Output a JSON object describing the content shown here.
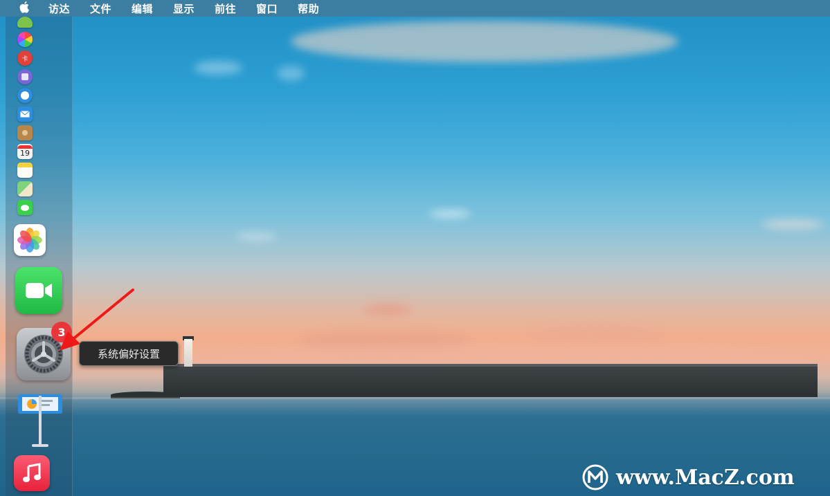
{
  "menubar": {
    "apple_icon": "apple-icon",
    "items": [
      "访达",
      "文件",
      "编辑",
      "显示",
      "前往",
      "窗口",
      "帮助"
    ]
  },
  "dock": {
    "small_apps": [
      {
        "name": "android-app-icon",
        "color": "#7cc44b"
      },
      {
        "name": "color-wheel-app-icon",
        "color": "#e8457b"
      },
      {
        "name": "red-app-icon",
        "color": "#e2403a"
      },
      {
        "name": "purple-app-icon",
        "color": "#7a66d6"
      },
      {
        "name": "safari-icon",
        "color": "#2f8de0"
      },
      {
        "name": "mail-icon",
        "color": "#2f8de0"
      },
      {
        "name": "contacts-icon",
        "color": "#b8864a"
      },
      {
        "name": "calendar-icon",
        "color": "#f5f5f5"
      },
      {
        "name": "notes-icon",
        "color": "#f6d23c"
      },
      {
        "name": "maps-icon",
        "color": "#5dbf5a"
      },
      {
        "name": "messages-icon",
        "color": "#3ad04a"
      }
    ],
    "calendar_day": "19",
    "system_prefs_badge": "3"
  },
  "tooltip": {
    "label": "系统偏好设置"
  },
  "watermark": {
    "text": "www.MacZ.com"
  }
}
